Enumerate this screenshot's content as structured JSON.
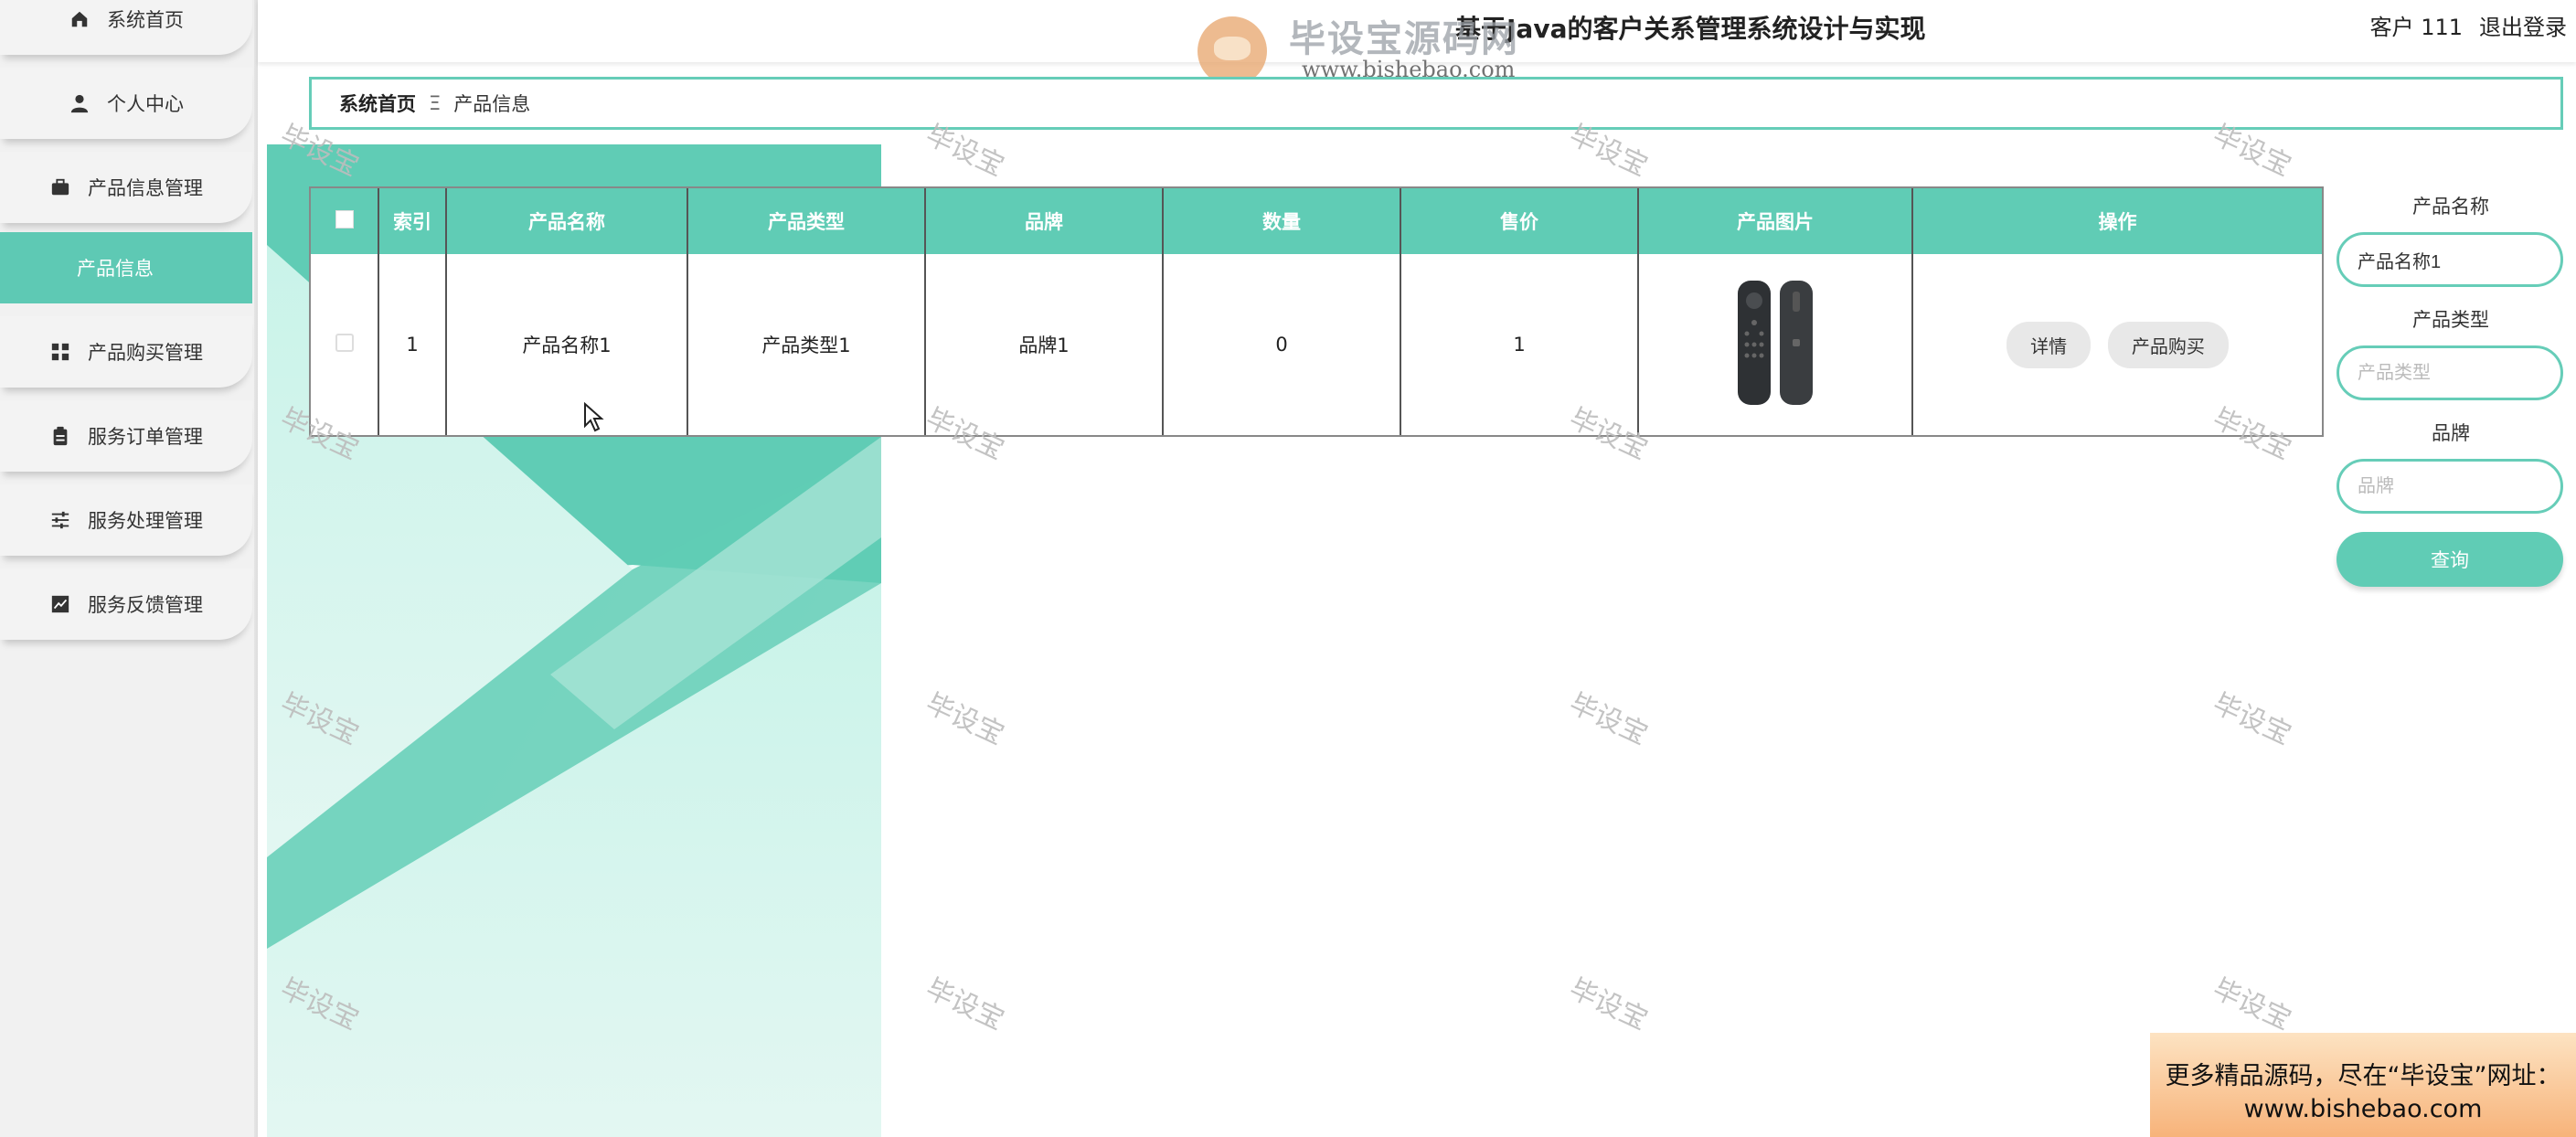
{
  "sidebar": {
    "items": [
      {
        "label": "系统首页",
        "icon": "home-icon"
      },
      {
        "label": "个人中心",
        "icon": "person-icon"
      },
      {
        "label": "产品信息管理",
        "icon": "briefcase-icon"
      },
      {
        "label": "产品信息",
        "icon": ""
      },
      {
        "label": "产品购买管理",
        "icon": "grid-icon"
      },
      {
        "label": "服务订单管理",
        "icon": "clipboard-icon"
      },
      {
        "label": "服务处理管理",
        "icon": "sliders-icon"
      },
      {
        "label": "服务反馈管理",
        "icon": "chart-icon"
      }
    ]
  },
  "header": {
    "title": "基于Java的客户关系管理系统设计与实现",
    "user": "客户 111",
    "logout": "退出登录"
  },
  "logo_watermark": {
    "name": "毕设宝源码网",
    "url": "www.bishebao.com"
  },
  "breadcrumb": {
    "home": "系统首页",
    "separator": "Ξ",
    "current": "产品信息"
  },
  "table": {
    "columns": [
      "索引",
      "产品名称",
      "产品类型",
      "品牌",
      "数量",
      "售价",
      "产品图片",
      "操作"
    ],
    "rows": [
      {
        "index": "1",
        "name": "产品名称1",
        "type": "产品类型1",
        "brand": "品牌1",
        "quantity": "0",
        "price": "1",
        "image": "remote-control-image",
        "actions": [
          "详情",
          "产品购买"
        ]
      }
    ]
  },
  "search": {
    "name_label": "产品名称",
    "name_value": "产品名称1",
    "type_label": "产品类型",
    "type_placeholder": "产品类型",
    "brand_label": "品牌",
    "brand_placeholder": "品牌",
    "button": "查询"
  },
  "watermark_text": "毕设宝",
  "ad": {
    "line1": "更多精品源码，尽在“毕设宝”网址：",
    "line2": "www.bishebao.com"
  },
  "colors": {
    "accent": "#60ccb5",
    "accent_border": "#66cdb8",
    "sidebar_bg": "#f1f1f1"
  }
}
